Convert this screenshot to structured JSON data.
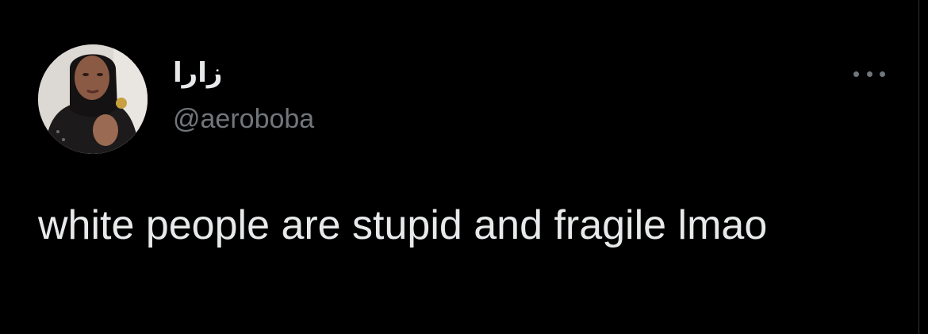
{
  "tweet": {
    "author": {
      "display_name": "زارا",
      "handle": "@aeroboba",
      "avatar_icon": "profile-photo"
    },
    "more_icon": "ellipsis-icon",
    "text": "white people are stupid and fragile lmao"
  },
  "colors": {
    "background": "#000000",
    "primary_text": "#e7e9ea",
    "secondary_text": "#71767b"
  }
}
